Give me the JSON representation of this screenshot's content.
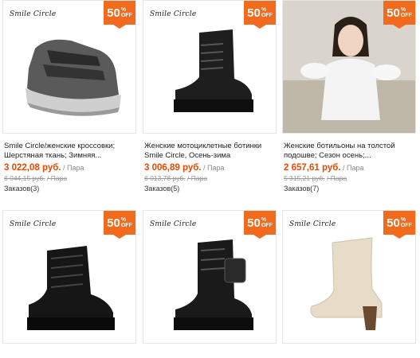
{
  "discount": {
    "value": "50",
    "unit_top": "%",
    "unit_bottom": "OFF"
  },
  "colors": {
    "badge": "#f26a1b",
    "price": "#e64a00"
  },
  "products": [
    {
      "brand": "Smile Circle",
      "title": "Smile Circle/женские кроссовки; Шерстяная ткань; Зимняя...",
      "price": "3 022,08 руб.",
      "unit": "/ Пара",
      "old_price": "6 044,15 руб.",
      "old_unit": "/ Пара",
      "orders": "Заказов(3)"
    },
    {
      "brand": "Smile Circle",
      "title": "Женские мотоциклетные ботинки Smile Circle, Осень-зима",
      "price": "3 006,89 руб.",
      "unit": "/ Пара",
      "old_price": "6 013,78 руб.",
      "old_unit": "/ Пара",
      "orders": "Заказов(5)"
    },
    {
      "brand": "",
      "title": "Женские ботильоны на толстой подошве; Сезон осень;...",
      "price": "2 657,61 руб.",
      "unit": "/ Пара",
      "old_price": "5 315,21 руб.",
      "old_unit": "/ Пара",
      "orders": "Заказов(7)"
    },
    {
      "brand": "Smile Circle"
    },
    {
      "brand": "Smile Circle"
    },
    {
      "brand": "Smile Circle"
    }
  ]
}
